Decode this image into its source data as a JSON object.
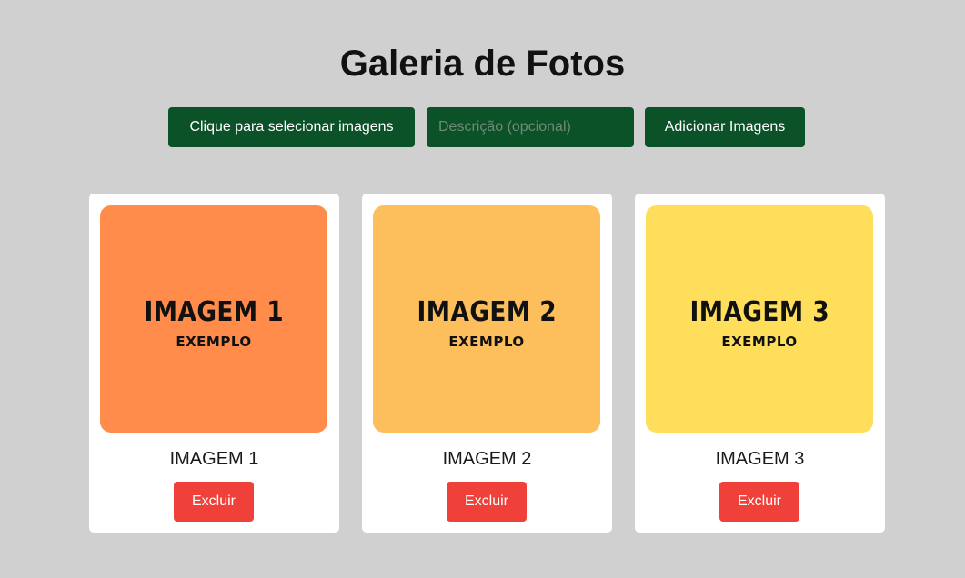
{
  "page": {
    "title": "Galeria de Fotos"
  },
  "toolbar": {
    "select_label": "Clique para selecionar imagens",
    "description_placeholder": "Descrição (opcional)",
    "description_value": "",
    "add_label": "Adicionar Imagens"
  },
  "gallery": {
    "items": [
      {
        "image_title": "IMAGEM 1",
        "image_subtitle": "EXEMPLO",
        "caption": "IMAGEM 1",
        "delete_label": "Excluir",
        "color": "#ff8c4a"
      },
      {
        "image_title": "IMAGEM 2",
        "image_subtitle": "EXEMPLO",
        "caption": "IMAGEM 2",
        "delete_label": "Excluir",
        "color": "#fdbf5c"
      },
      {
        "image_title": "IMAGEM 3",
        "image_subtitle": "EXEMPLO",
        "caption": "IMAGEM 3",
        "delete_label": "Excluir",
        "color": "#ffde5c"
      }
    ]
  },
  "colors": {
    "background": "#d0d0d0",
    "primary_button": "#0b5228",
    "danger_button": "#f0403a",
    "card": "#ffffff"
  }
}
